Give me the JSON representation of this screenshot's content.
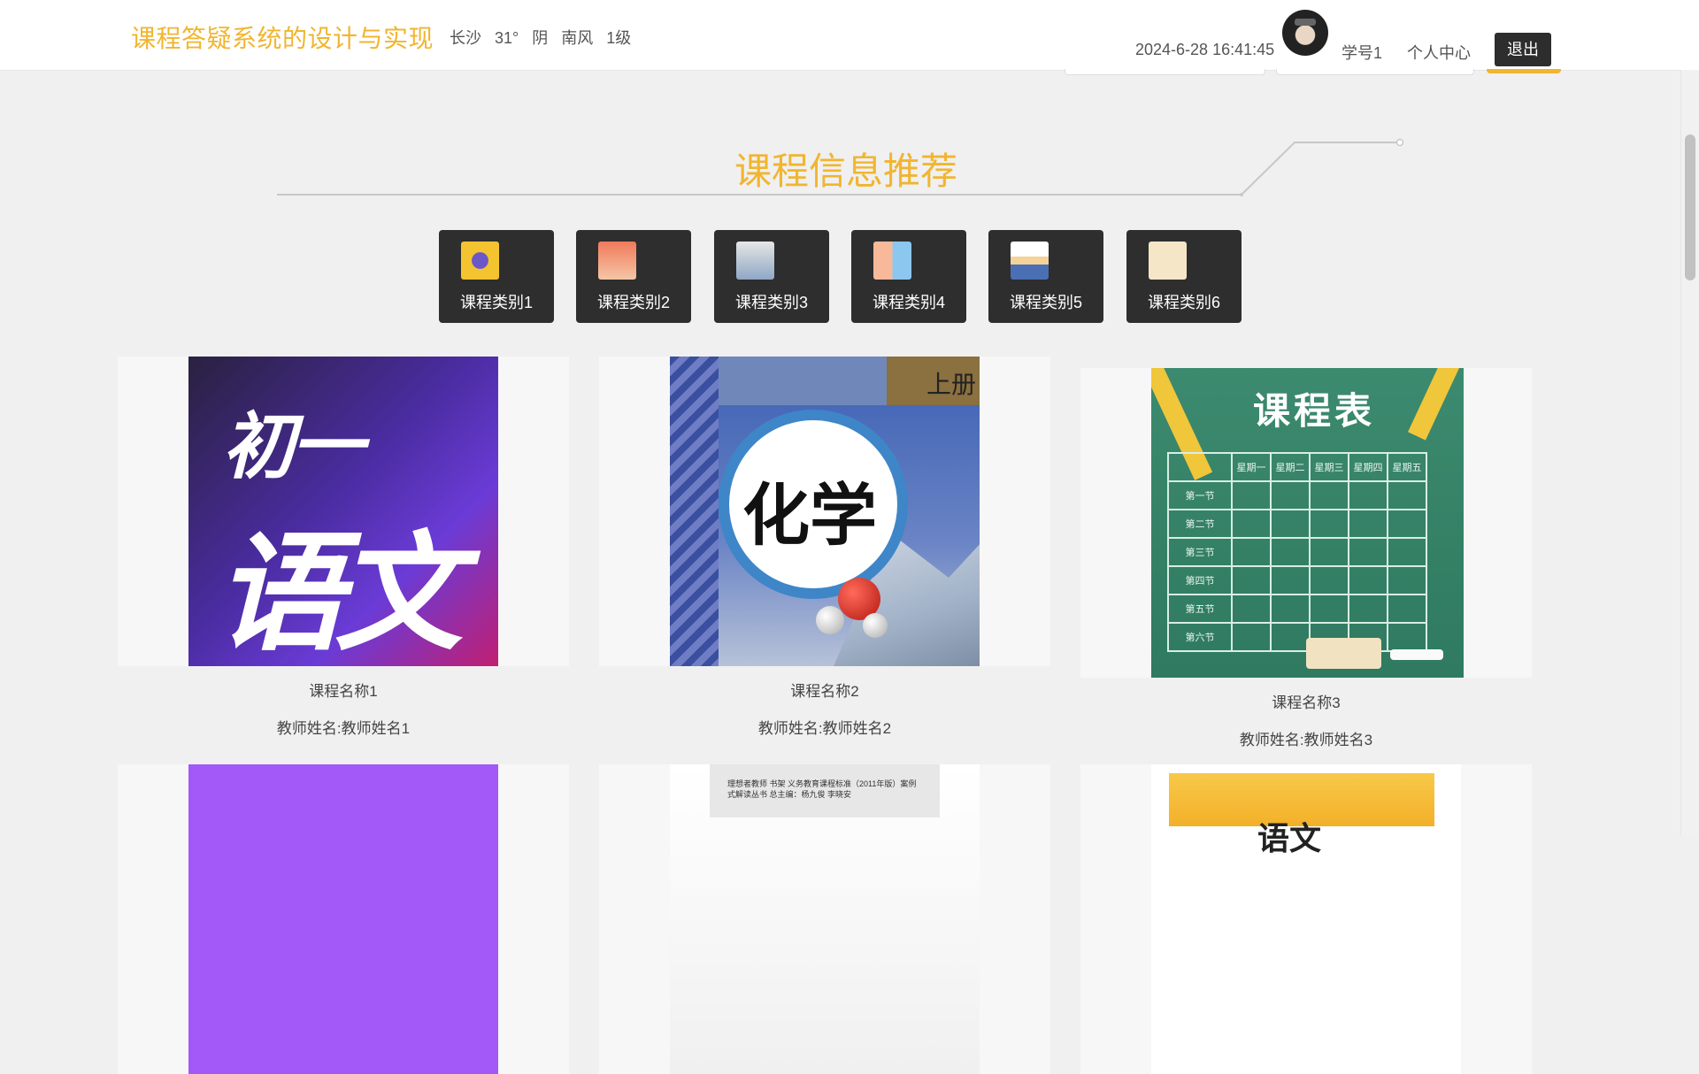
{
  "header": {
    "title": "课程答疑系统的设计与实现",
    "weather": {
      "city": "长沙",
      "temp": "31°",
      "condition": "阴",
      "wind": "南风",
      "level": "1级"
    },
    "datetime": "2024-6-28 16:41:45",
    "user": "学号1",
    "profile_link": "个人中心",
    "logout_label": "退出"
  },
  "section": {
    "title": "课程信息推荐"
  },
  "categories": [
    {
      "label": "课程类别1"
    },
    {
      "label": "课程类别2"
    },
    {
      "label": "课程类别3"
    },
    {
      "label": "课程类别4"
    },
    {
      "label": "课程类别5"
    },
    {
      "label": "课程类别6"
    }
  ],
  "courses": [
    {
      "name": "课程名称1",
      "teacher": "教师姓名:教师姓名1",
      "cover_text_1": "初一",
      "cover_text_2": "语文"
    },
    {
      "name": "课程名称2",
      "teacher": "教师姓名:教师姓名2",
      "cover_text": "化学",
      "cover_corner": "上册"
    },
    {
      "name": "课程名称3",
      "teacher": "教师姓名:教师姓名3",
      "cover_text": "课程表",
      "schedule_days": [
        "星期一",
        "星期二",
        "星期三",
        "星期四",
        "星期五"
      ],
      "schedule_periods": [
        "第一节",
        "第二节",
        "第三节",
        "第四节",
        "第五节",
        "第六节"
      ]
    },
    {
      "cover_text": ""
    },
    {
      "cover_text": "理想者教师 书架 义务教育课程标准（2011年版）案例式解读丛书 总主编：杨九俊 李晓安"
    },
    {
      "cover_text": "语文"
    }
  ],
  "colors": {
    "accent": "#f1b52f",
    "dark": "#2e2e2e",
    "background": "#f0f0f0"
  }
}
